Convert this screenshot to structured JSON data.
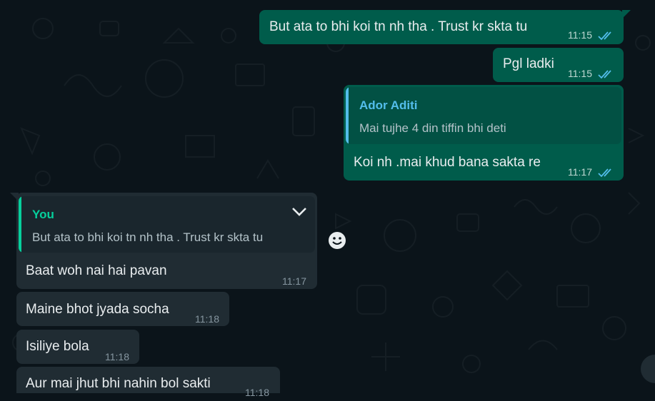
{
  "colors": {
    "background": "#0b141a",
    "outgoing_bubble": "#005c4b",
    "incoming_bubble": "#202c33",
    "read_ticks": "#53bdeb",
    "quote_author_outgoing": "#53bdeb",
    "quote_author_incoming": "#06cf9c"
  },
  "messages_out": [
    {
      "text": "But ata to bhi koi tn nh tha . Trust kr skta tu",
      "time": "11:15",
      "status": "read"
    },
    {
      "text": "Pgl ladki",
      "time": "11:15",
      "status": "read"
    },
    {
      "quote": {
        "author": "Ador Aditi",
        "text": "Mai tujhe 4 din tiffin bhi deti"
      },
      "text": "Koi nh .mai khud bana sakta re",
      "time": "11:17",
      "status": "read"
    }
  ],
  "messages_in": [
    {
      "quote": {
        "author": "You",
        "text": "But ata to bhi koi tn nh tha . Trust kr skta tu"
      },
      "text": "Baat woh nai hai pavan",
      "time": "11:17"
    },
    {
      "text": "Maine bhot jyada socha",
      "time": "11:18"
    },
    {
      "text": "Isiliye bola",
      "time": "11:18"
    },
    {
      "text": "Aur mai jhut bhi nahin bol sakti",
      "time": "11:18"
    }
  ]
}
